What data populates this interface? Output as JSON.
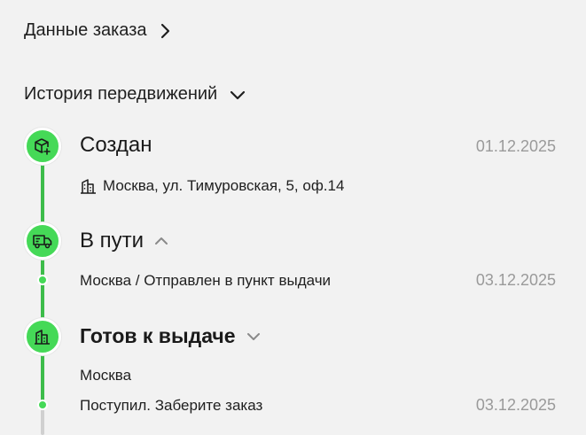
{
  "order_details": {
    "label": "Данные заказа",
    "icon": "chevron-right-icon"
  },
  "history": {
    "label": "История передвижений",
    "icon": "chevron-down-icon",
    "statuses": [
      {
        "title": "Создан",
        "icon": "package-plus-icon",
        "date": "01.12.2025",
        "events": [
          {
            "text": "Москва, ул. Тимуровская, 5, оф.14",
            "icon": "building-icon"
          }
        ]
      },
      {
        "title": "В пути",
        "icon": "truck-icon",
        "toggle_icon": "chevron-up-icon",
        "events": [
          {
            "text": "Москва / Отправлен в пункт выдачи",
            "date": "03.12.2025"
          }
        ]
      },
      {
        "title": "Готов к выдаче",
        "icon": "building-icon",
        "toggle_icon": "chevron-down-icon",
        "events": [
          {
            "text": "Москва"
          },
          {
            "text": "Поступил. Заберите заказ",
            "date": "03.12.2025"
          }
        ]
      }
    ]
  },
  "colors": {
    "accent": "#45d957",
    "timeline": "#3dbc4a",
    "date_text": "#9a9a9a",
    "background": "#f2f2f2"
  }
}
